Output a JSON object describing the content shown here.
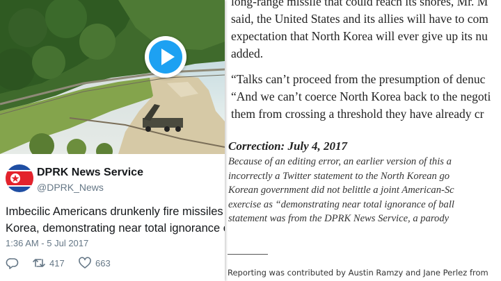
{
  "article": {
    "paragraph1": [
      "long-range missile that could reach its shores, Mr. M",
      "said, the United States and its allies will have to com",
      "expectation that North Korea will ever give up its nu",
      "added."
    ],
    "paragraph2": [
      "“Talks can’t proceed from the presumption of denuc",
      "“And we can’t coerce North Korea back to the negoti",
      "them from crossing a threshold they have already cr"
    ],
    "correction": {
      "title": "Correction: July 4, 2017",
      "lines": [
        "Because of an editing error, an earlier version of this a",
        "incorrectly a Twitter statement to the North Korean go",
        "Korean government did not belittle a joint American-Sc",
        "exercise as “demonstrating near total ignorance of ball",
        "statement was from the DPRK News Service, a parody"
      ]
    },
    "credit": "Reporting was contributed by Austin Ramzy and Jane Perlez from"
  },
  "tweet": {
    "display_name": "DPRK News Service",
    "handle": "@DPRK_News",
    "text_lines": [
      "Imbecilic Americans drunkenly fire missiles in",
      "Korea, demonstrating near total ignorance of"
    ],
    "timestamp": "1:36 AM - 5 Jul 2017",
    "retweets": "417",
    "likes": "663",
    "colors": {
      "accent": "#1da1f2",
      "text": "#14171a",
      "muted": "#657786",
      "flag_red": "#e3232c",
      "flag_blue": "#1f4ea3"
    },
    "icons": [
      "play-icon",
      "reply-icon",
      "retweet-icon",
      "heart-icon",
      "flag-avatar"
    ]
  }
}
